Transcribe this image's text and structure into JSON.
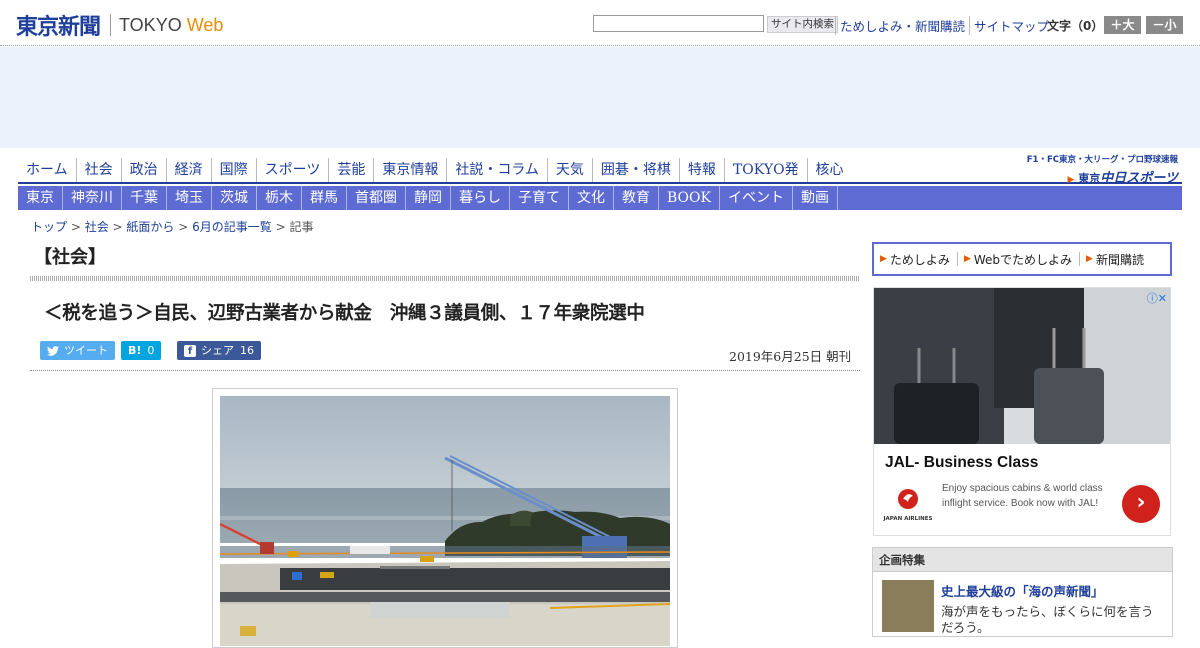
{
  "header": {
    "logo_jp": "東京新聞",
    "logo_en1": "TOKYO",
    "logo_en2": "Web",
    "search_button": "サイト内検索",
    "links": [
      "ためしよみ・新聞購読",
      "サイトマップ"
    ],
    "font_size_label": "文字（0）",
    "font_larger": "＋大",
    "font_smaller": "－小"
  },
  "nav_primary": [
    "ホーム",
    "社会",
    "政治",
    "経済",
    "国際",
    "スポーツ",
    "芸能",
    "東京情報",
    "社説・コラム",
    "天気",
    "囲碁・将棋",
    "特報",
    "TOKYO発",
    "核心"
  ],
  "sports": {
    "line1": "F1・FC東京・大リーグ・プロ野球速報",
    "line2_prefix": "東京",
    "line2_brand": "中日スポーツ"
  },
  "nav_secondary": [
    "東京",
    "神奈川",
    "千葉",
    "埼玉",
    "茨城",
    "栃木",
    "群馬",
    "首都圏",
    "静岡",
    "暮らし",
    "子育て",
    "文化",
    "教育",
    "BOOK",
    "イベント",
    "動画"
  ],
  "breadcrumb": {
    "items": [
      "トップ",
      "社会",
      "紙面から",
      "6月の記事一覧"
    ],
    "current": "記事",
    "sep": " > "
  },
  "section_title": "【社会】",
  "article": {
    "headline": "＜税を追う＞自民、辺野古業者から献金　沖縄３議員側、１７年衆院選中",
    "date": "2019年6月25日 朝刊",
    "tweet_label": "ツイート",
    "hatena_label": "B!",
    "hatena_count": "0",
    "share_label": "シェア",
    "share_count": "16"
  },
  "sidebar": {
    "links": [
      "ためしよみ",
      "Webでためしよみ",
      "新聞購読"
    ],
    "ad": {
      "title": "JAL- Business Class",
      "body": "Enjoy spacious cabins & world class inflight service. Book now with JAL!",
      "brand": "JAPAN AIRLINES",
      "cta": "›"
    },
    "feature": {
      "heading": "企画特集",
      "title": "史上最大級の「海の声新聞」",
      "subtitle": "海が声をもったら、ぼくらに何を言うだろう。"
    }
  },
  "colors": {
    "brand_blue": "#1f3f9a",
    "nav_blue": "#5d6bd3",
    "accent_orange": "#e88c00",
    "ad_red": "#d0211b"
  }
}
